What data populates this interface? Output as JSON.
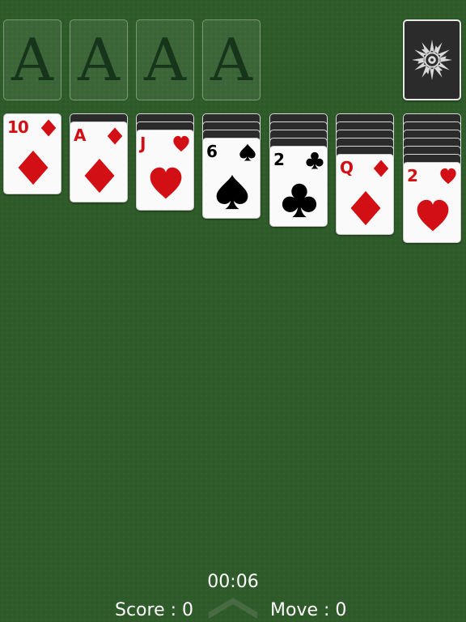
{
  "foundations": [
    {
      "label": "A"
    },
    {
      "label": "A"
    },
    {
      "label": "A"
    },
    {
      "label": "A"
    }
  ],
  "stock": {
    "icon": "sun-emblem-icon"
  },
  "tableau": [
    {
      "face_down": 0,
      "top": {
        "rank": "10",
        "suit": "diamond",
        "color": "red"
      }
    },
    {
      "face_down": 1,
      "top": {
        "rank": "A",
        "suit": "diamond",
        "color": "red"
      }
    },
    {
      "face_down": 2,
      "top": {
        "rank": "J",
        "suit": "heart",
        "color": "red"
      }
    },
    {
      "face_down": 3,
      "top": {
        "rank": "6",
        "suit": "spade",
        "color": "black"
      }
    },
    {
      "face_down": 4,
      "top": {
        "rank": "2",
        "suit": "club",
        "color": "black"
      }
    },
    {
      "face_down": 5,
      "top": {
        "rank": "Q",
        "suit": "diamond",
        "color": "red"
      }
    },
    {
      "face_down": 6,
      "top": {
        "rank": "2",
        "suit": "heart",
        "color": "red"
      }
    }
  ],
  "status": {
    "timer": "00:06",
    "score": "Score : 0",
    "move": "Move : 0"
  },
  "colors": {
    "felt": "#2e5b29",
    "red_suit": "#d10f14",
    "black_suit": "#000000",
    "card_back": "#2b2b2b"
  }
}
